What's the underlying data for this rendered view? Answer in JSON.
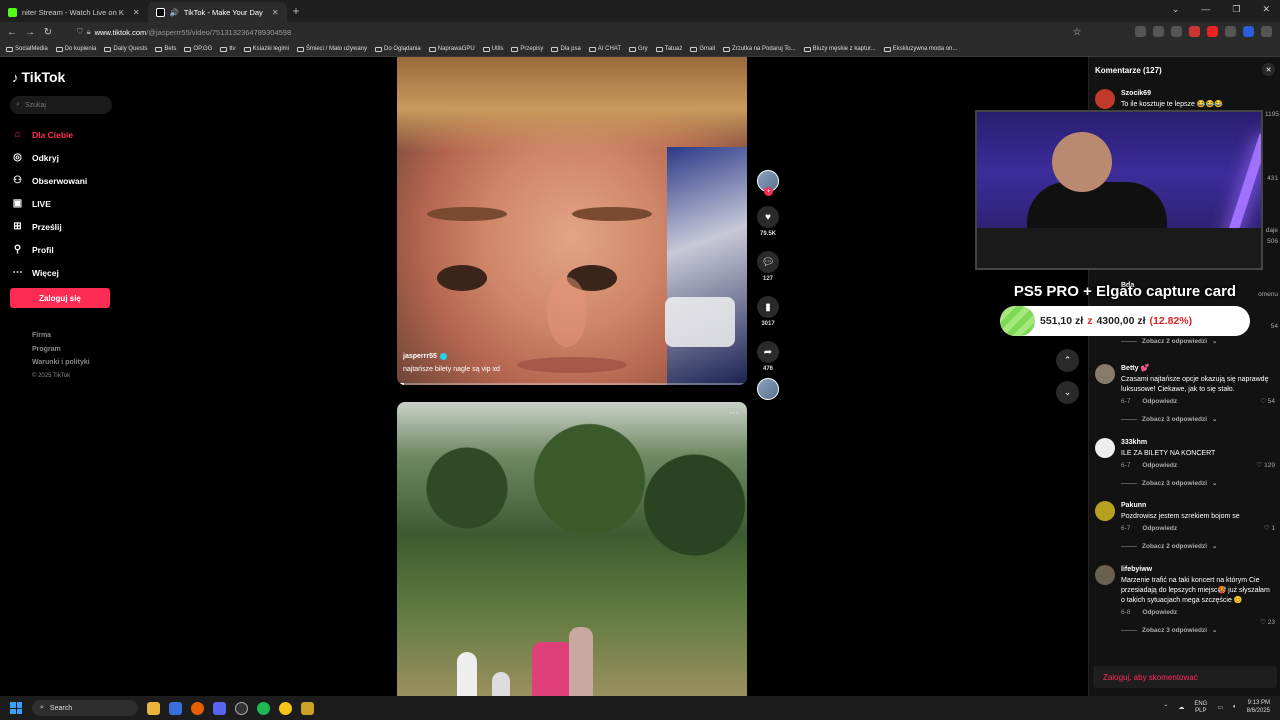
{
  "browser": {
    "tabs": [
      {
        "title": "niter Stream - Watch Live on K",
        "active": false
      },
      {
        "title": "TikTok - Make Your Day",
        "active": true
      }
    ],
    "new_tab": "+",
    "window_controls": [
      "⌄",
      "—",
      "❐",
      "✕"
    ],
    "url_domain": "www.tiktok.com",
    "url_path": "/@jasperrr55/video/7513132364789304598",
    "bookmarks": [
      "SocialMedia",
      "Do kupienia",
      "Daily Quests",
      "Bets",
      "OP.GG",
      "ttv",
      "Ksiazki legimi",
      "Śmieci / Mało używany",
      "Do Oglądania",
      "NaprawaGPU",
      "Utils",
      "Przepisy",
      "Dla psa",
      "AI CHAT",
      "Gry",
      "Tatuaż",
      "Gmail",
      "Zrzutka na Podaruj To...",
      "Bluzy męskie z kaptur...",
      "Ekskluzywna moda on..."
    ]
  },
  "sidebar": {
    "logo_text": "TikTok",
    "search_placeholder": "Szukaj",
    "items": [
      {
        "label": "Dla Ciebie",
        "icon": "home-icon",
        "active": true
      },
      {
        "label": "Odkryj",
        "icon": "compass-icon",
        "active": false
      },
      {
        "label": "Obserwowani",
        "icon": "following-icon",
        "active": false
      },
      {
        "label": "LIVE",
        "icon": "live-icon",
        "active": false
      },
      {
        "label": "Prześlij",
        "icon": "upload-icon",
        "active": false
      },
      {
        "label": "Profil",
        "icon": "profile-icon",
        "active": false
      },
      {
        "label": "Więcej",
        "icon": "more-icon",
        "active": false
      }
    ],
    "login_label": "Zaloguj się",
    "footer": [
      "Firma",
      "Program",
      "Warunki i polityki"
    ],
    "copyright": "© 2025 TikTok"
  },
  "video": {
    "username": "jasperrr55",
    "caption": "najtańsze bilety nagle są vip xd",
    "progress": 0.02
  },
  "actions": {
    "likes": "79.5K",
    "comments": "127",
    "saves": "3017",
    "shares": "476"
  },
  "overlay": {
    "title": "PS5 PRO + Elgato capture card",
    "current": "551,10 zł",
    "sep": "z",
    "goal": "4300,00 zł",
    "percent": "(12.82%)",
    "progress": 0.1282
  },
  "comments": {
    "header": "Komentarze (127)",
    "items": [
      {
        "user": "Szocik69",
        "text": "To ile kosztuje te lepsze 😂😂😂",
        "date": "",
        "likes": "1195",
        "more": ""
      },
      {
        "user": "Betty 💕",
        "text": "Czasami najtańsze opcje okazują się naprawdę luksusowe! Ciekawe, jak to się stało.",
        "date": "6-7",
        "likes": "54",
        "more": "Zobacz 3 odpowiedzi"
      },
      {
        "user": "333khm",
        "text": "ILE ZA BILETY NA KONCERT",
        "date": "6-7",
        "likes": "129",
        "more": "Zobacz 3 odpowiedzi"
      },
      {
        "user": "Pakunn",
        "text": "Pozdrowisz jestem szrekiem bojom se",
        "date": "6-7",
        "likes": "1",
        "more": "Zobacz 2 odpowiedzi"
      },
      {
        "user": "lifebyiww",
        "text": "Marzenie trafić na taki koncert na którym Cie przesiadają do lepszych miejsc🥵 już słyszałam o takich sytuacjach mega szczęście 😊",
        "date": "6-8",
        "likes": "23",
        "more": "Zobacz 3 odpowiedzi"
      }
    ],
    "partial_visible": {
      "user": "Bda",
      "text": "omenu",
      "likes_a": "431",
      "likes_b": "506",
      "likes_c": "54",
      "side_text": "daje",
      "more": "Zobacz 2 odpowiedzi"
    },
    "reply_label": "Odpowiedz",
    "login_prompt": "Zaloguj, aby skomentować"
  },
  "taskbar": {
    "search_label": "Search",
    "lang_top": "ENG",
    "lang_bottom": "PLP",
    "time": "9:13 PM",
    "date": "8/6/2025"
  }
}
